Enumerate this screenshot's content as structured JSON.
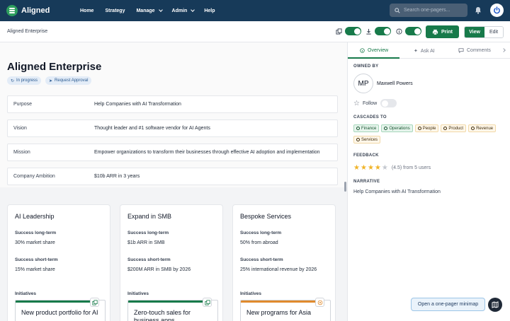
{
  "app": {
    "name": "Aligned"
  },
  "nav": {
    "home": "Home",
    "strategy": "Strategy",
    "manage": "Manage",
    "admin": "Admin",
    "help": "Help"
  },
  "search": {
    "placeholder": "Search one-pagers..."
  },
  "toolbar": {
    "breadcrumb": "Aligned Enterprise",
    "print_label": "Print",
    "view_label": "View",
    "edit_label": "Edit",
    "toggles": [
      {
        "icon": "copy-icon",
        "on": true
      },
      {
        "icon": "download-icon",
        "on": true
      },
      {
        "icon": "info-icon",
        "on": true
      }
    ]
  },
  "page": {
    "title": "Aligned Enterprise",
    "status_badge": "In progress",
    "approval_badge": "Request Approval",
    "rows": [
      {
        "label": "Purpose",
        "value": "Help Companies with AI Transformation"
      },
      {
        "label": "Vision",
        "value": "Thought leader and #1 software vendor for AI Agents"
      },
      {
        "label": "Mission",
        "value": "Empower organizations to transform their businesses through effective AI adoption and implementation"
      },
      {
        "label": "Company Ambition",
        "value": "$10b ARR in 3 years"
      }
    ],
    "cards": [
      {
        "title": "AI Leadership",
        "long_label": "Success long-term",
        "long_value": "30% market share",
        "short_label": "Success short-term",
        "short_value": "15% market share",
        "initiatives_label": "Initiatives",
        "initiative": "New product portfolio for AI",
        "bar_color": "#177a4a"
      },
      {
        "title": "Expand in SMB",
        "long_label": "Success long-term",
        "long_value": "$1b ARR in SMB",
        "short_label": "Success short-term",
        "short_value": "$200M ARR in SMB by 2026",
        "initiatives_label": "Initiatives",
        "initiative": "Zero-touch sales for business apps",
        "bar_color": "#177a4a"
      },
      {
        "title": "Bespoke Services",
        "long_label": "Success long-term",
        "long_value": "50% from abroad",
        "short_label": "Success short-term",
        "short_value": "25% international revenue by 2026",
        "initiatives_label": "Initiatives",
        "initiative": "New programs for Asia",
        "bar_color": "#e08a2e"
      }
    ]
  },
  "panel": {
    "tabs": {
      "overview": "Overview",
      "ask_ai": "Ask AI",
      "comments": "Comments"
    },
    "owned_by_heading": "OWNED BY",
    "owner_initials": "MP",
    "owner_name": "Maxwell Powers",
    "follow_label": "Follow",
    "cascades_heading": "CASCADES TO",
    "cascades": [
      {
        "label": "Finance",
        "tone": "green"
      },
      {
        "label": "Operations",
        "tone": "green"
      },
      {
        "label": "People",
        "tone": "amber"
      },
      {
        "label": "Product",
        "tone": "amber"
      },
      {
        "label": "Revenue",
        "tone": "amber"
      },
      {
        "label": "Services",
        "tone": "amber"
      }
    ],
    "feedback_heading": "FEEDBACK",
    "rating": 4.5,
    "rating_text": "(4.5) from 5 users",
    "narrative_heading": "NARRATIVE",
    "narrative": "Help Companies with AI Transformation"
  },
  "minimap_button": "Open a one-pager minimap",
  "colors": {
    "nav_bg": "#173a59",
    "accent": "#177a4a",
    "star": "#f0b429"
  }
}
